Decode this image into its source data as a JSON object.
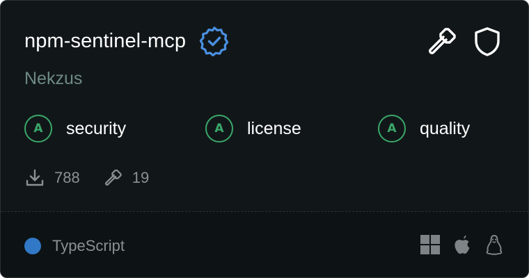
{
  "card": {
    "title": "npm-sentinel-mcp",
    "author": "Nekzus",
    "verified_icon": "verified-badge-icon",
    "actions": [
      {
        "icon": "hammer-icon"
      },
      {
        "icon": "shield-icon"
      }
    ],
    "grades": [
      {
        "grade": "A",
        "label": "security"
      },
      {
        "grade": "A",
        "label": "license"
      },
      {
        "grade": "A",
        "label": "quality"
      }
    ],
    "stats": {
      "downloads": "788",
      "tools": "19"
    },
    "language": {
      "name": "TypeScript",
      "color": "#3178c6"
    },
    "platforms": [
      "windows-icon",
      "apple-icon",
      "linux-icon"
    ]
  },
  "colors": {
    "background": "#111719",
    "footer_background": "#0d1214",
    "grade_accent": "#3aa86a",
    "verified_accent": "#4a90e2",
    "muted_text": "#8a9094",
    "author_text": "#6f8a86"
  }
}
